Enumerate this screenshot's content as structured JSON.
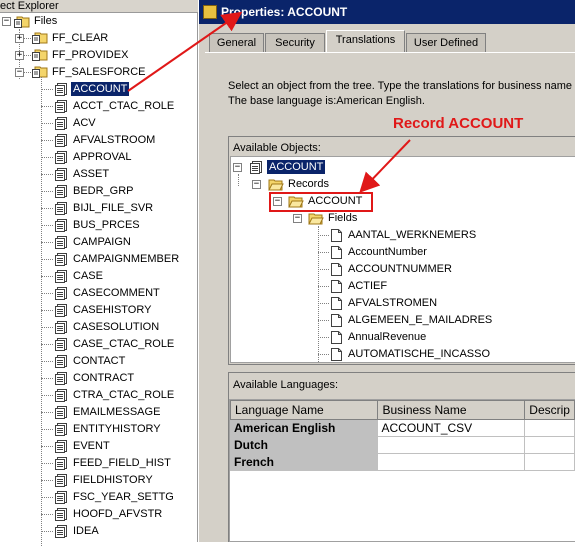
{
  "explorer": {
    "title": "ect Explorer",
    "root_label": "Files",
    "projects": [
      "FF_CLEAR",
      "FF_PROVIDEX",
      "FF_SALESFORCE"
    ],
    "items": [
      "ACCOUNT",
      "ACCT_CTAC_ROLE",
      "ACV",
      "AFVALSTROOM",
      "APPROVAL",
      "ASSET",
      "BEDR_GRP",
      "BIJL_FILE_SVR",
      "BUS_PRCES",
      "CAMPAIGN",
      "CAMPAIGNMEMBER",
      "CASE",
      "CASECOMMENT",
      "CASEHISTORY",
      "CASESOLUTION",
      "CASE_CTAC_ROLE",
      "CONTACT",
      "CONTRACT",
      "CTRA_CTAC_ROLE",
      "EMAILMESSAGE",
      "ENTITYHISTORY",
      "EVENT",
      "FEED_FIELD_HIST",
      "FIELDHISTORY",
      "FSC_YEAR_SETTG",
      "HOOFD_AFVSTR",
      "IDEA"
    ],
    "selected": "ACCOUNT"
  },
  "props": {
    "title": "Properties: ACCOUNT",
    "tabs": [
      "General",
      "Security",
      "Translations",
      "User Defined"
    ],
    "active_tab": "Translations",
    "instruction_line1": "Select an object from the tree. Type the translations for business name a",
    "instruction_line2": "The base language is:American English.",
    "available_objects_label": "Available Objects:",
    "object_tree": {
      "root": "ACCOUNT",
      "records": "Records",
      "record": "ACCOUNT",
      "fields_label": "Fields",
      "fields": [
        "AANTAL_WERKNEMERS",
        "AccountNumber",
        "ACCOUNTNUMMER",
        "ACTIEF",
        "AFVALSTROMEN",
        "ALGEMEEN_E_MAILADRES",
        "AnnualRevenue",
        "AUTOMATISCHE_INCASSO"
      ]
    },
    "available_languages_label": "Available Languages:",
    "grid": {
      "headers": [
        "Language Name",
        "Business Name",
        "Descrip"
      ],
      "rows": [
        {
          "lang": "American English",
          "business": "ACCOUNT_CSV",
          "desc": ""
        },
        {
          "lang": "Dutch",
          "business": "",
          "desc": ""
        },
        {
          "lang": "French",
          "business": "",
          "desc": ""
        }
      ]
    }
  },
  "annotation": {
    "text": "Record ACCOUNT",
    "color": "#e01818"
  }
}
